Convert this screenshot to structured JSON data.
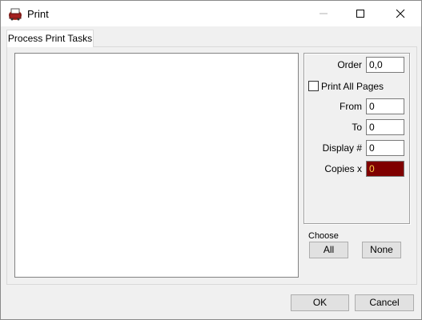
{
  "window": {
    "title": "Print",
    "icon": "printer-app-icon",
    "controls": {
      "minimize": "minimize-icon",
      "maximize": "maximize-icon",
      "close": "close-icon"
    }
  },
  "tabs": [
    {
      "label": "Process Print Tasks",
      "active": true
    }
  ],
  "options": {
    "order_label": "Order",
    "order_value": "0,0",
    "print_all_pages_label": "Print All Pages",
    "print_all_pages_checked": false,
    "from_label": "From",
    "from_value": "0",
    "to_label": "To",
    "to_value": "0",
    "display_label": "Display #",
    "display_value": "0",
    "copies_label": "Copies x",
    "copies_value": "0",
    "copies_bg_color": "#7f0000",
    "copies_text_color": "#ffd24a"
  },
  "choose": {
    "label": "Choose",
    "all_label": "All",
    "none_label": "None"
  },
  "footer": {
    "ok_label": "OK",
    "cancel_label": "Cancel"
  }
}
